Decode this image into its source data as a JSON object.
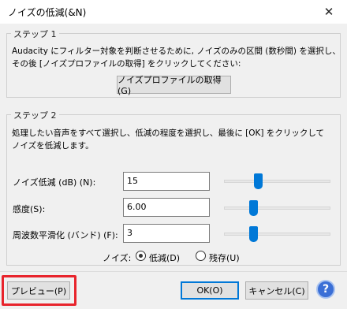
{
  "window": {
    "title": "ノイズの低減(&N)",
    "close_glyph": "✕"
  },
  "step1": {
    "legend": "ステップ 1",
    "desc_line1": "Audacity にフィルター対象を判断させるために, ノイズのみの区間 (数秒間) を選択し、",
    "desc_line2": "その後 [ノイズプロファイルの取得] をクリックしてください:",
    "get_profile_button": "ノイズプロファイルの取得(G)"
  },
  "step2": {
    "legend": "ステップ 2",
    "desc_line1": "処理したい音声をすべて選択し、低減の程度を選択し、最後に [OK] をクリックして",
    "desc_line2": "ノイズを低減します。",
    "params": [
      {
        "label": "ノイズ低減 (dB) (N):",
        "value": "15",
        "slider_fraction": 0.32
      },
      {
        "label": "感度(S):",
        "value": "6.00",
        "slider_fraction": 0.27
      },
      {
        "label": "周波数平滑化 (バンド) (F):",
        "value": "3",
        "slider_fraction": 0.27
      }
    ],
    "noise_label": "ノイズ:",
    "noise_options": [
      {
        "label": "低減(D)",
        "checked": true
      },
      {
        "label": "残存(U)",
        "checked": false
      }
    ]
  },
  "footer": {
    "preview_button": "プレビュー(P)",
    "ok_button": "OK(O)",
    "cancel_button": "キャンセル(C)",
    "help_glyph": "?"
  },
  "colors": {
    "accent": "#0078d7",
    "highlight": "#e8242c",
    "help": "#3b6fd6"
  },
  "icons": [
    "close-icon",
    "help-icon"
  ]
}
